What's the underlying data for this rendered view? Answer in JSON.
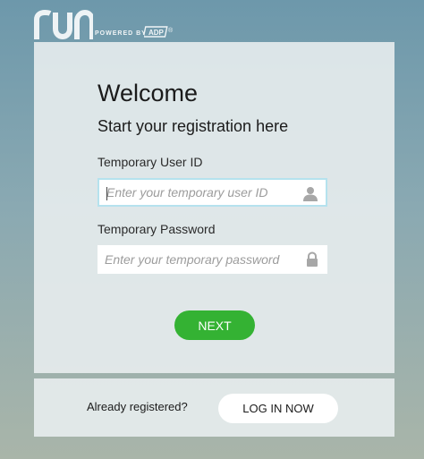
{
  "brand": {
    "logo_text": "run",
    "powered_by": "POWERED BY",
    "partner_logo": "ADP",
    "partner_mark": "®"
  },
  "colors": {
    "accent_green": "#34b233",
    "focus_border": "#b5e2ee",
    "card_background": "#e8edee"
  },
  "registration": {
    "title": "Welcome",
    "subtitle": "Start your registration here",
    "user_id": {
      "label": "Temporary User ID",
      "placeholder": "Enter your temporary user ID",
      "value": "",
      "icon": "user-icon"
    },
    "password": {
      "label": "Temporary Password",
      "placeholder": "Enter your temporary password",
      "value": "",
      "icon": "lock-icon"
    },
    "next_label": "NEXT"
  },
  "login": {
    "prompt": "Already registered?",
    "button_label": "LOG IN NOW"
  }
}
